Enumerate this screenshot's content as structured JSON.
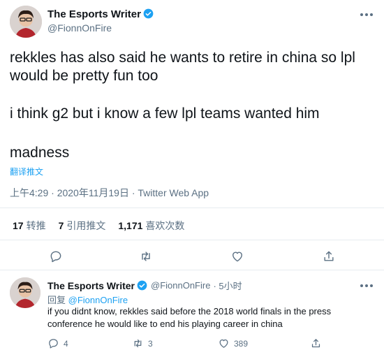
{
  "colors": {
    "accent": "#1da1f2",
    "text": "#0f1419",
    "muted": "#5b7083",
    "divider": "#e6ecf0"
  },
  "tweet": {
    "author_name": "The Esports Writer",
    "author_handle": "@FionnOnFire",
    "verified": true,
    "lines": [
      "rekkles has also said he wants to retire in china so lpl",
      "would be pretty fun too",
      "i think g2 but i know a few lpl teams wanted him",
      "madness"
    ],
    "translate_label": "翻译推文",
    "timestamp": "上午4:29 · 2020年11月19日 · Twitter Web App",
    "stats": {
      "retweets": {
        "count": "17",
        "label": "转推"
      },
      "quotes": {
        "count": "7",
        "label": "引用推文"
      },
      "likes": {
        "count": "1,171",
        "label": "喜欢次数"
      }
    },
    "actions": [
      "reply-icon",
      "retweet-icon",
      "like-icon",
      "share-icon"
    ]
  },
  "reply": {
    "author_name": "The Esports Writer",
    "author_handle": "@FionnOnFire",
    "time_ago": "· 5小时",
    "replying_prefix": "回复",
    "replying_to": "@FionnOnFire",
    "lines": [
      "if you didnt know, rekkles said before the 2018 world finals in the press",
      "conference he would like to end his playing career in china"
    ],
    "counts": {
      "replies": "4",
      "retweets": "3",
      "likes": "389"
    }
  }
}
